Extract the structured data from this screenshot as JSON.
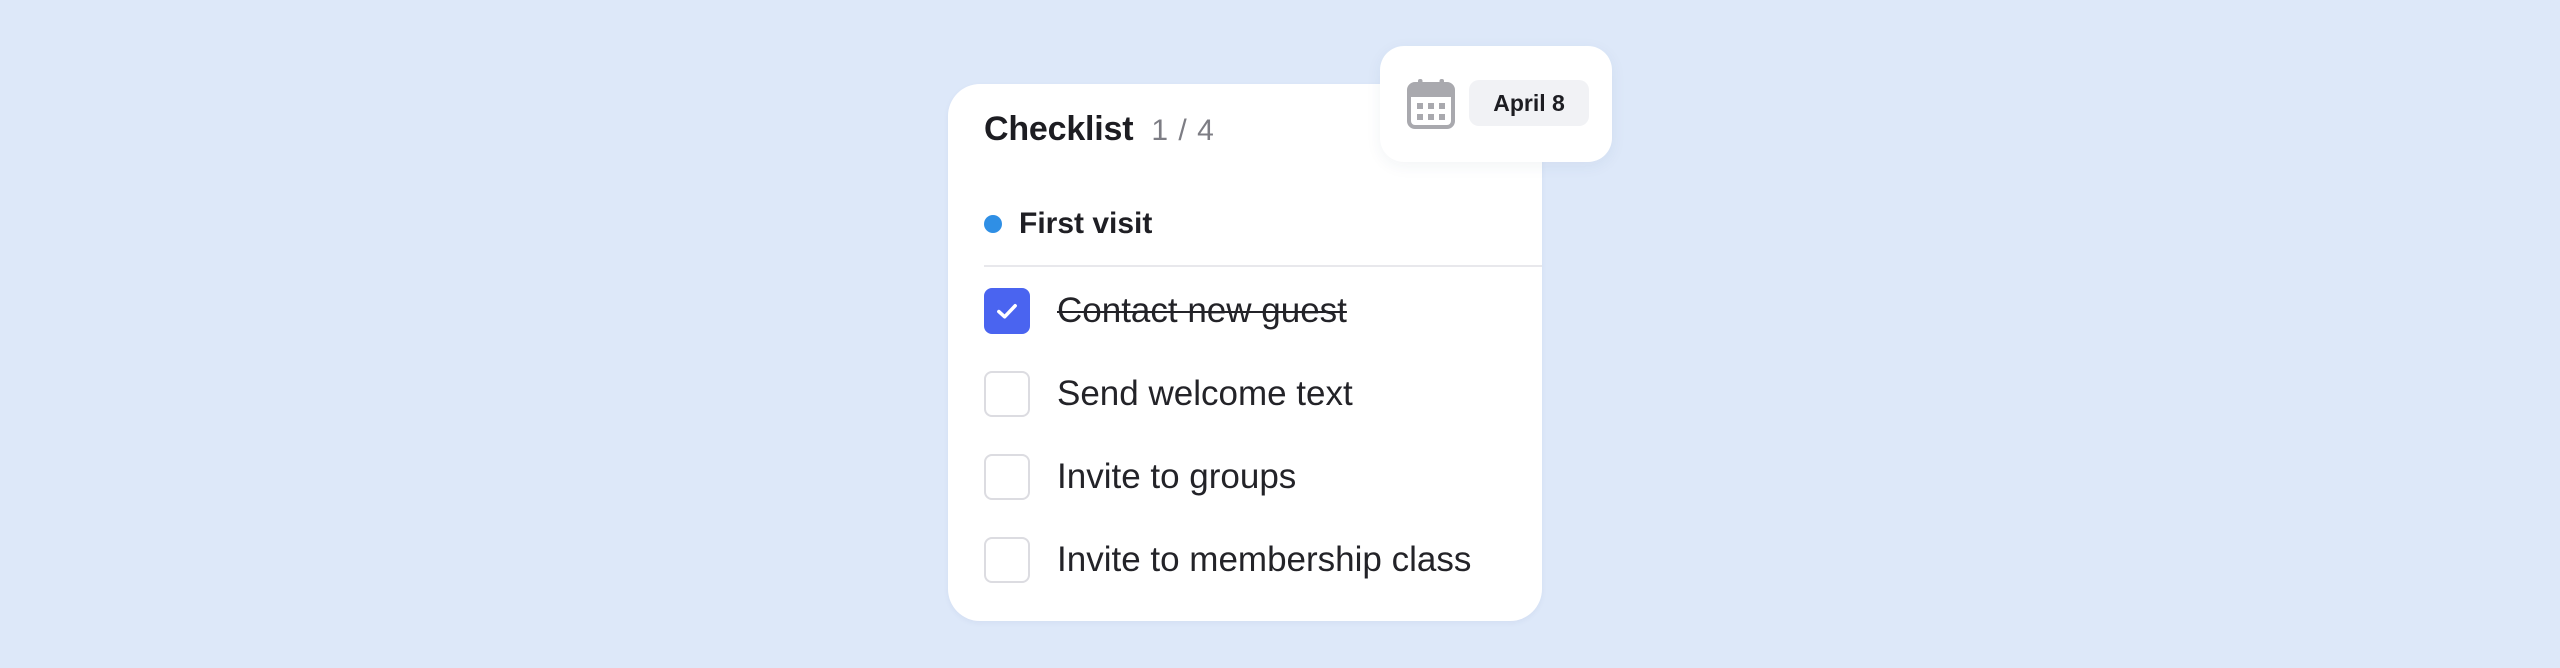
{
  "checklist": {
    "title": "Checklist",
    "count": "1 / 4",
    "section": {
      "label": "First visit",
      "dot_color": "#2f8fe5"
    },
    "items": [
      {
        "label": "Contact new guest",
        "checked": true
      },
      {
        "label": "Send welcome text",
        "checked": false
      },
      {
        "label": "Invite to groups",
        "checked": false
      },
      {
        "label": "Invite to membership class",
        "checked": false
      }
    ],
    "accent_color": "#4a64f0"
  },
  "due_date": {
    "icon": "calendar-icon",
    "label": "April 8"
  },
  "colors": {
    "background": "#dde8f9",
    "card": "#ffffff",
    "muted_text": "#7d7d84",
    "icon_gray": "#a9a9ae"
  }
}
